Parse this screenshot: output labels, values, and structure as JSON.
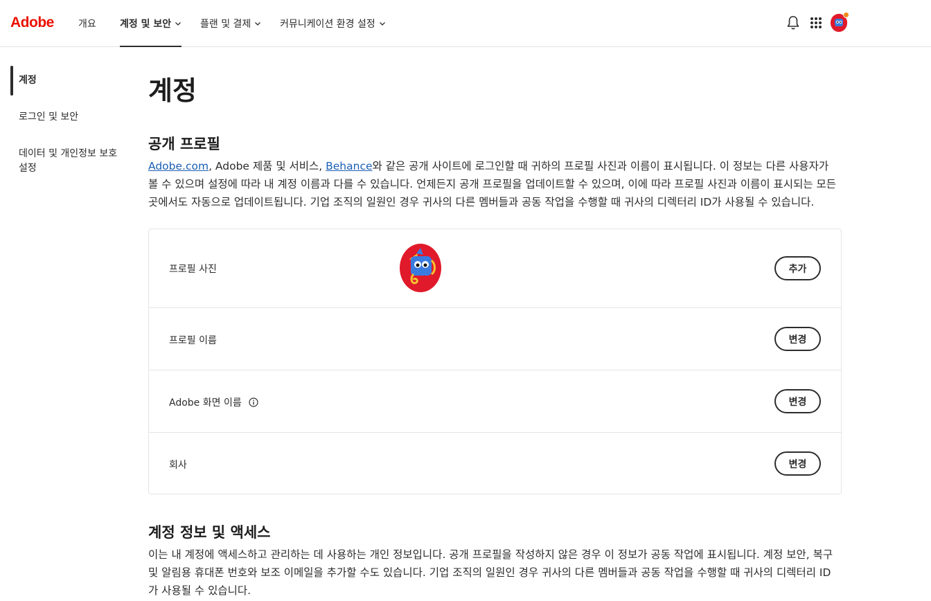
{
  "header": {
    "logo": "Adobe",
    "nav": [
      {
        "label": "개요"
      },
      {
        "label": "계정 및 보안"
      },
      {
        "label": "플랜 및 결제"
      },
      {
        "label": "커뮤니케이션 환경 설정"
      }
    ],
    "icons": [
      "bell-icon",
      "apps-grid-icon",
      "avatar"
    ]
  },
  "sidebar": {
    "items": [
      {
        "label": "계정"
      },
      {
        "label": "로그인 및 보안"
      },
      {
        "label": "데이터 및 개인정보 보호 설정"
      }
    ]
  },
  "main": {
    "title": "계정",
    "public_profile": {
      "heading": "공개 프로필",
      "link1": "Adobe.com",
      "text1": ", Adobe 제품 및 서비스, ",
      "link2": "Behance",
      "text2": "와 같은 공개 사이트에 로그인할 때 귀하의 프로필 사진과 이름이 표시됩니다. 이 정보는 다른 사용자가 볼 수 있으며 설정에 따라 내 계정 이름과 다를 수 있습니다. 언제든지 공개 프로필을 업데이트할 수 있으며, 이에 따라 프로필 사진과 이름이 표시되는 모든 곳에서도 자동으로 업데이트됩니다. 기업 조직의 일원인 경우 귀사의 다른 멤버들과 공동 작업을 수행할 때 귀사의 디렉터리 ID가 사용될 수 있습니다.",
      "rows": [
        {
          "label": "프로필 사진",
          "button": "추가"
        },
        {
          "label": "프로필 이름",
          "button": "변경"
        },
        {
          "label": "Adobe 화면 이름",
          "button": "변경"
        },
        {
          "label": "회사",
          "button": "변경"
        }
      ]
    },
    "account_info": {
      "heading": "계정 정보 및 액세스",
      "text": "이는 내 계정에 액세스하고 관리하는 데 사용하는 개인 정보입니다. 공개 프로필을 작성하지 않은 경우 이 정보가 공동 작업에 표시됩니다. 계정 보안, 복구 및 알림용 휴대폰 번호와 보조 이메일을 추가할 수도 있습니다. 기업 조직의 일원인 경우 귀사의 다른 멤버들과 공동 작업을 수행할 때 귀사의 디렉터리 ID가 사용될 수 있습니다."
    }
  },
  "colors": {
    "brand": "#eb1000",
    "link": "#1a5fb4",
    "text": "#2c2c2c"
  }
}
